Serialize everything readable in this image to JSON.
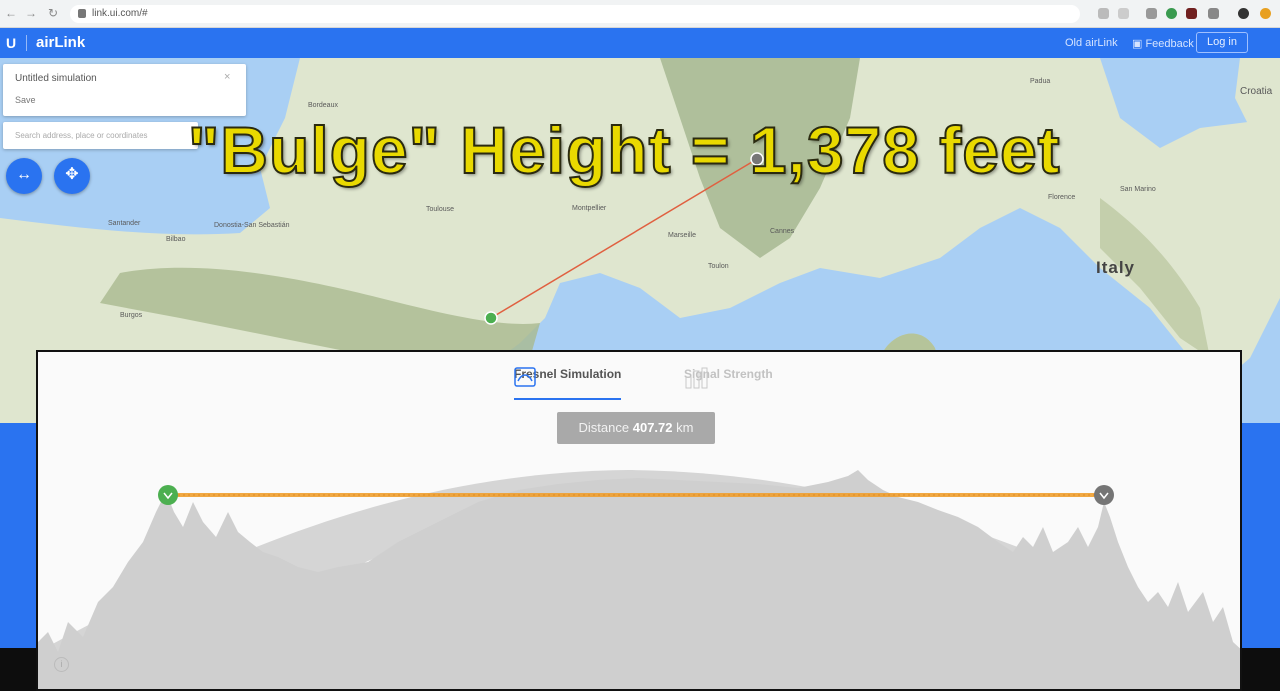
{
  "browser": {
    "url": "link.ui.com/#"
  },
  "header": {
    "logo": "U",
    "brand": "airLink",
    "old_link": "Old airLink",
    "feedback": "Feedback",
    "login": "Log in"
  },
  "simulation": {
    "title": "Untitled simulation",
    "save": "Save",
    "close": "×"
  },
  "search": {
    "placeholder": "Search address, place or coordinates"
  },
  "map": {
    "places": {
      "italy": "Italy",
      "croatia": "Croatia",
      "toulouse": "Toulouse",
      "montpellier": "Montpellier",
      "marseille": "Marseille",
      "bordeaux": "Bordeaux",
      "bilbao": "Bilbao",
      "burgos": "Burgos",
      "santander": "Santander",
      "donostia": "Donostia-San Sebastián",
      "florence": "Florence",
      "san_marino": "San Marino",
      "padua": "Padua",
      "toulon": "Toulon",
      "cannes": "Cannes"
    },
    "zoom_in": "+",
    "zoom_out": "−"
  },
  "overlay": {
    "headline": "\"Bulge\" Height = 1,378 feet"
  },
  "fresnel": {
    "tab_fresnel": "Fresnel Simulation",
    "tab_signal": "Signal Strength",
    "distance_label": "Distance",
    "distance_value": "407.72",
    "distance_unit": "km",
    "info": "i"
  },
  "colors": {
    "accent": "#2a73f0",
    "headline": "#e9d900",
    "station_a": "#4caf50",
    "station_b": "#757575",
    "beam": "#f0a030"
  }
}
